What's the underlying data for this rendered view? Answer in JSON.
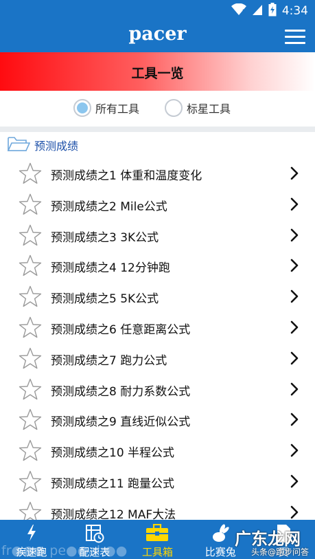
{
  "status_bar": {
    "time": "4:34"
  },
  "app_bar": {
    "title": "pacer"
  },
  "banner": {
    "title": "工具一览"
  },
  "filter": {
    "options": [
      {
        "label": "所有工具",
        "selected": true
      },
      {
        "label": "标星工具",
        "selected": false
      }
    ]
  },
  "group": {
    "label": "预测成绩"
  },
  "items": [
    {
      "label": "预测成绩之1 体重和温度变化"
    },
    {
      "label": "预测成绩之2 Mile公式"
    },
    {
      "label": "预测成绩之3 3K公式"
    },
    {
      "label": "预测成绩之4 12分钟跑"
    },
    {
      "label": "预测成绩之5 5K公式"
    },
    {
      "label": "预测成绩之6 任意距离公式"
    },
    {
      "label": "预测成绩之7 跑力公式"
    },
    {
      "label": "预测成绩之8 耐力系数公式"
    },
    {
      "label": "预测成绩之9 直线近似公式"
    },
    {
      "label": "预测成绩之10 半程公式"
    },
    {
      "label": "预测成绩之11 跑量公式"
    },
    {
      "label": "预测成绩之12 MAF大法"
    }
  ],
  "tabs": [
    {
      "label": "疾速跑",
      "icon": "lightning-icon",
      "active": false
    },
    {
      "label": "配速表",
      "icon": "pace-table-icon",
      "active": false
    },
    {
      "label": "工具箱",
      "icon": "toolbox-icon",
      "active": true
    },
    {
      "label": "比赛兔",
      "icon": "rabbit-icon",
      "active": false
    },
    {
      "label": "页",
      "icon": "page-icon",
      "active": false
    }
  ],
  "watermark": {
    "left": "fr●●● pe●●al ●●",
    "brand": "广东龙网",
    "small": "头条@跑步问答"
  },
  "colors": {
    "primary": "#1a74c6",
    "active_tab": "#ffd700",
    "group_label": "#1c4fa8"
  }
}
